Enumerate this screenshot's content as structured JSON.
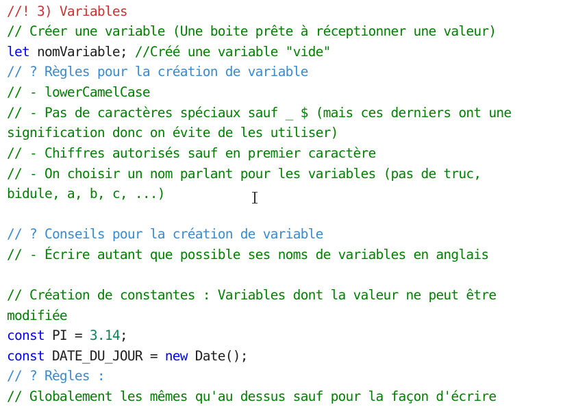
{
  "code": {
    "l01": "//! 3) Variables",
    "l02": "// Créer une variable (Une boite prête à réceptionner une valeur)",
    "l03_kw": "let",
    "l03_rest": " nomVariable; ",
    "l03_comment": "//Créé une variable \"vide\"",
    "l04": "// ? Règles pour la création de variable",
    "l05": "// - lowerCamelCase",
    "l06": "// - Pas de caractères spéciaux sauf _ $ (mais ces derniers ont une",
    "l07": "signification donc on évite de les utiliser)",
    "l08": "// - Chiffres autorisés sauf en premier caractère",
    "l09": "// - On choisir un nom parlant pour les variables (pas de truc,",
    "l10": "bidule, a, b, c, ...)",
    "l11": "// ? Conseils pour la création de variable",
    "l12": "// - Écrire autant que possible ses noms de variables en anglais",
    "l13": "// Création de constantes : Variables dont la valeur ne peut être",
    "l14": "modifiée",
    "l15_kw": "const",
    "l15_rest": " PI = ",
    "l15_num": "3.14",
    "l15_end": ";",
    "l16_kw": "const",
    "l16_rest": " DATE_DU_JOUR = ",
    "l16_kw2": "new",
    "l16_rest2": " Date();",
    "l17": "// ? Règles :",
    "l18": "// Globalement les mêmes qu'au dessus sauf pour la façon d'écrire"
  },
  "colors": {
    "red_comment": "#cd3131",
    "green_comment": "#008000",
    "blue_comment": "#3a8ad0",
    "keyword": "#0000ff",
    "text": "#1e1e1e",
    "number": "#098658"
  },
  "icons": {
    "cursor": "text-cursor-icon"
  }
}
